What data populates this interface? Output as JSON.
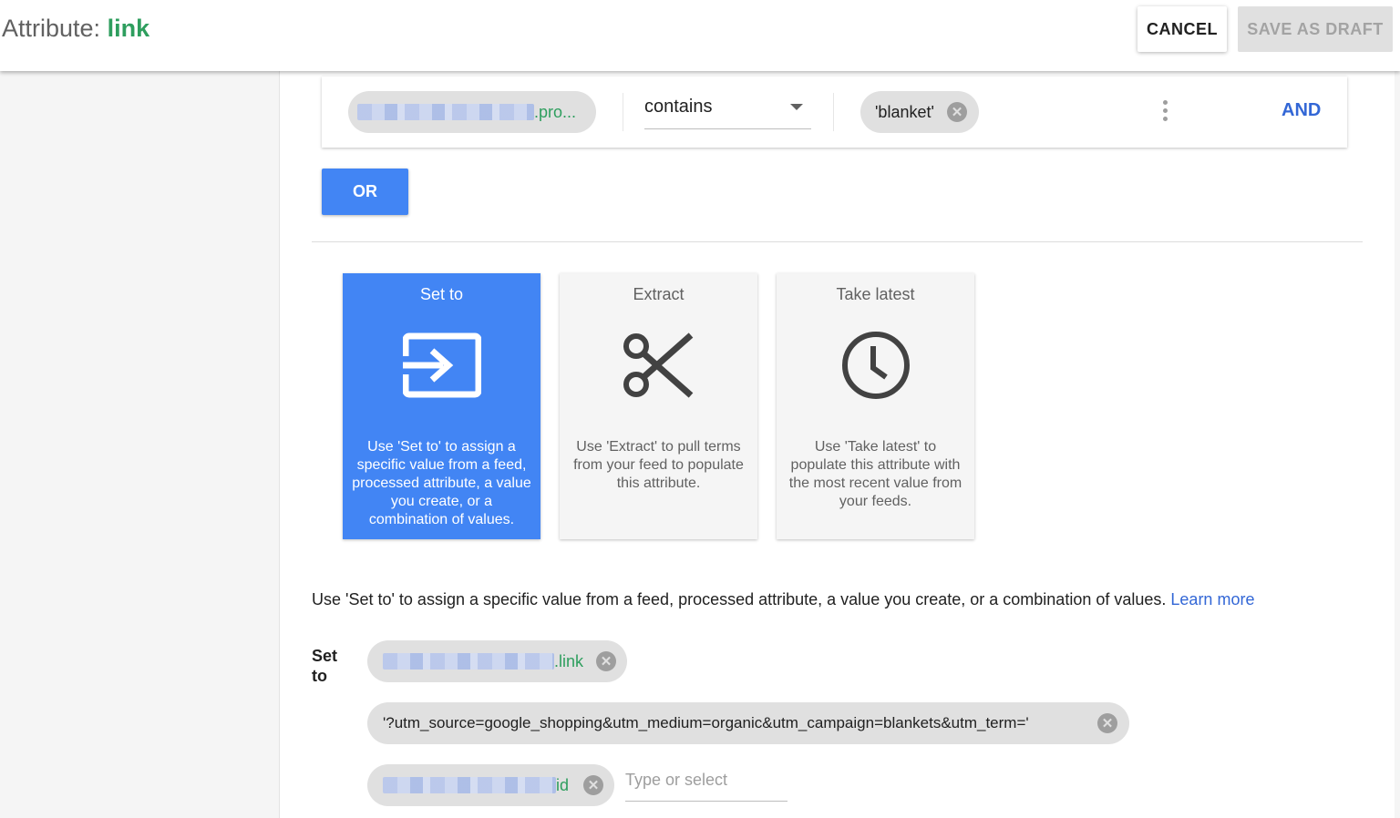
{
  "header": {
    "title_prefix": "Attribute:",
    "title_attribute": "link",
    "cancel_label": "CANCEL",
    "save_draft_label": "SAVE AS DRAFT"
  },
  "condition": {
    "attribute_chip_suffix": ".pro...",
    "operator": "contains",
    "value_chip": "'blanket'",
    "and_label": "AND"
  },
  "or_label": "OR",
  "options": [
    {
      "title": "Set to",
      "icon": "set-to-icon",
      "description": "Use 'Set to' to assign a specific value from a feed, processed attribute, a value you create, or a combination of values.",
      "selected": true
    },
    {
      "title": "Extract",
      "icon": "scissors-icon",
      "description": "Use 'Extract' to pull terms from your feed to populate this attribute.",
      "selected": false
    },
    {
      "title": "Take latest",
      "icon": "clock-icon",
      "description": "Use 'Take latest' to populate this attribute with the most recent value from your feeds.",
      "selected": false
    }
  ],
  "help": {
    "text": "Use 'Set to' to assign a specific value from a feed, processed attribute, a value you create, or a combination of values.",
    "learn_more": "Learn more"
  },
  "set_to": {
    "label": "Set to",
    "chips": [
      {
        "suffix": ".link"
      },
      {
        "text": "'?utm_source=google_shopping&utm_medium=organic&utm_campaign=blankets&utm_term='"
      },
      {
        "suffix": "id"
      }
    ],
    "input_placeholder": "Type or select"
  },
  "colors": {
    "accent_blue": "#4285f4",
    "link_blue": "#3367d6",
    "attribute_green": "#2e9e5e"
  }
}
